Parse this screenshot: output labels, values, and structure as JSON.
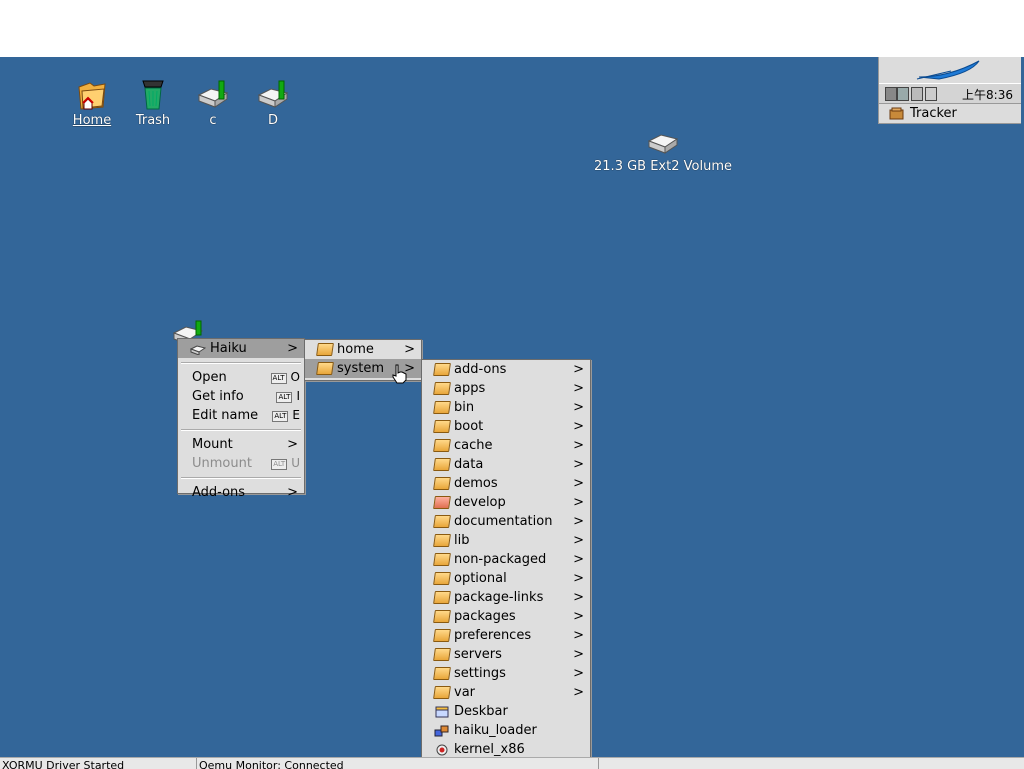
{
  "desktop": {
    "icons": [
      {
        "label": "Home"
      },
      {
        "label": "Trash"
      },
      {
        "label": "c"
      },
      {
        "label": "D"
      },
      {
        "label": "21.3 GB Ext2 Volume"
      }
    ]
  },
  "deskbar": {
    "clock": "上午8:36",
    "tracker_label": "Tracker"
  },
  "context_menu": {
    "items": [
      {
        "label": "Haiku",
        "arrow": ">"
      },
      {
        "label": "Open",
        "alt": "ALT",
        "key": "O"
      },
      {
        "label": "Get info",
        "alt": "ALT",
        "key": "I"
      },
      {
        "label": "Edit name",
        "alt": "ALT",
        "key": "E"
      },
      {
        "label": "Mount",
        "arrow": ">"
      },
      {
        "label": "Unmount",
        "alt": "ALT",
        "key": "U"
      },
      {
        "label": "Add-ons",
        "arrow": ">"
      }
    ]
  },
  "haiku_menu": {
    "items": [
      {
        "label": "home",
        "arrow": ">"
      },
      {
        "label": "system",
        "arrow": ">"
      }
    ]
  },
  "system_menu": {
    "items": [
      {
        "label": "add-ons",
        "arrow": ">"
      },
      {
        "label": "apps",
        "arrow": ">"
      },
      {
        "label": "bin",
        "arrow": ">"
      },
      {
        "label": "boot",
        "arrow": ">"
      },
      {
        "label": "cache",
        "arrow": ">"
      },
      {
        "label": "data",
        "arrow": ">"
      },
      {
        "label": "demos",
        "arrow": ">"
      },
      {
        "label": "develop",
        "arrow": ">"
      },
      {
        "label": "documentation",
        "arrow": ">"
      },
      {
        "label": "lib",
        "arrow": ">"
      },
      {
        "label": "non-packaged",
        "arrow": ">"
      },
      {
        "label": "optional",
        "arrow": ">"
      },
      {
        "label": "package-links",
        "arrow": ">"
      },
      {
        "label": "packages",
        "arrow": ">"
      },
      {
        "label": "preferences",
        "arrow": ">"
      },
      {
        "label": "servers",
        "arrow": ">"
      },
      {
        "label": "settings",
        "arrow": ">"
      },
      {
        "label": "var",
        "arrow": ">"
      },
      {
        "label": "Deskbar"
      },
      {
        "label": "haiku_loader"
      },
      {
        "label": "kernel_x86"
      }
    ]
  },
  "statusbar": {
    "left": "XORMU Driver Started",
    "middle": "Qemu Monitor: Connected"
  }
}
